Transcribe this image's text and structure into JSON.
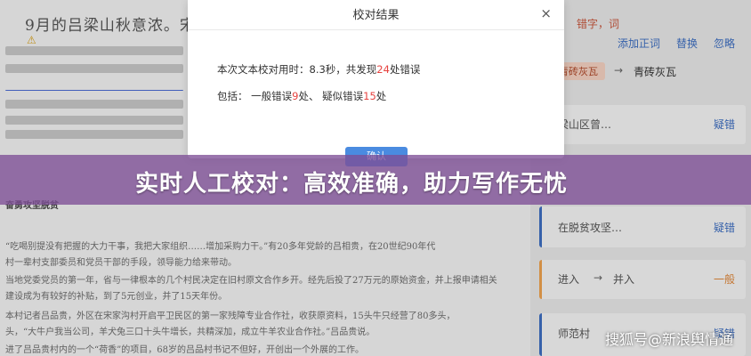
{
  "document": {
    "title": "9月的吕梁山秋意浓。宋",
    "warning_icon": "warning-icon",
    "section_heading": "奋勇攻坚脱贫",
    "lines": [
      "“吃喝别提没有把握的大力干事，我把大家组织……增加采购力干。”有20多年党龄的吕相贵，在20世纪90年代",
      "村一辈村支部委员和党员干部的手段，领导能力给来带动。",
      "当地党委党员的第一年，省与一律根本的几个村民决定在旧村原文合作乡开。经先后投了27万元的原始资金，并上报申请相关",
      "建设成为有较好的补贴，到了5元创业，并了15天年份。",
      "本村记者吕品贵，外区在宋家沟村开启平卫民区的第一家残障专业合作社，收获原资料，15头牛只经营了80多头，",
      "头，“大牛户我当公司，羊犬兔三口十头牛增长，共精深加，成立牛羊农业合作社。”吕品贵说。",
      "进了吕品贵村内的一个“荷香”的项目，68岁的吕品村书记不但好，开创出一个外展的工作。"
    ]
  },
  "panel": {
    "top_text": "错字，词",
    "tabs": [
      "添加正词",
      "替换",
      "忽略"
    ],
    "pill": "青砖灰瓦",
    "pill_replace": "青砖灰瓦",
    "cards": [
      {
        "text": "梁山区曾…",
        "action": "疑错"
      },
      {
        "text": "在脱贫攻坚…",
        "action": "疑错"
      },
      {
        "from": "进入",
        "to": "并入",
        "action": "一般"
      },
      {
        "text": "师范村",
        "action": "疑错"
      }
    ]
  },
  "modal": {
    "title": "校对结果",
    "close_label": "×",
    "line1_pre": "本次文本校对用时：8.3秒，共发现",
    "line1_count": "24",
    "line1_post": "处错误",
    "line2_pre": "包括：  一般错误",
    "line2_general": "9",
    "line2_mid": "处、  疑似错误",
    "line2_suspect": "15",
    "line2_post": "处",
    "confirm_label": "确认"
  },
  "banner": {
    "text": "实时人工校对：高效准确，助力写作无忧"
  },
  "watermark": {
    "text": "搜狐号@新浪舆情通"
  },
  "colors": {
    "banner": "#7d4e96",
    "error_red": "#e64340",
    "link_blue": "#3e6fc2",
    "accent_orange": "#f0a34f"
  }
}
